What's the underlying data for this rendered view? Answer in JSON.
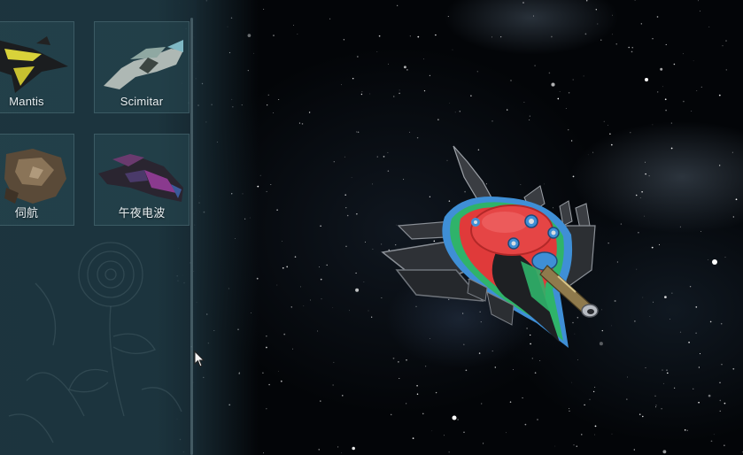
{
  "inventory": {
    "items": [
      {
        "label": "Mantis",
        "icon": "mantis-ship-icon"
      },
      {
        "label": "Scimitar",
        "icon": "scimitar-ship-icon"
      },
      {
        "label": "伺航",
        "icon": "companion-ship-icon"
      },
      {
        "label": "午夜电波",
        "icon": "nightwave-ship-icon"
      }
    ]
  },
  "colors": {
    "panel": "#1e3741",
    "ship_hull_red": "#e03a3a",
    "ship_stripe_green": "#2fb36a",
    "ship_stripe_blue": "#3f8fd6",
    "ship_metal": "#3a3d42"
  },
  "viewer": {
    "selected_item": "午夜电波"
  }
}
